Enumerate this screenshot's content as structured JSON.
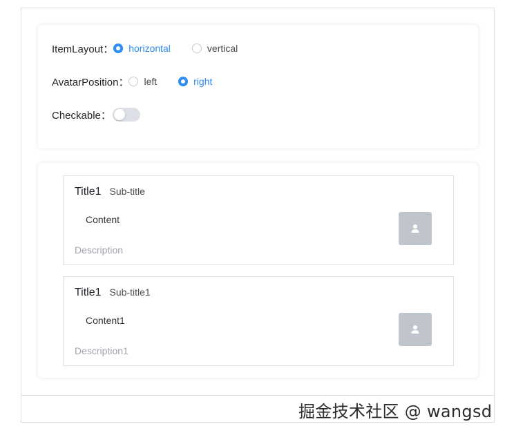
{
  "settings": {
    "item_layout": {
      "label": "ItemLayout：",
      "options": [
        {
          "label": "horizontal",
          "checked": true
        },
        {
          "label": "vertical",
          "checked": false
        }
      ]
    },
    "avatar_position": {
      "label": "AvatarPosition：",
      "options": [
        {
          "label": "left",
          "checked": false
        },
        {
          "label": "right",
          "checked": true
        }
      ]
    },
    "checkable": {
      "label": "Checkable：",
      "value": false
    }
  },
  "list": {
    "items": [
      {
        "title": "Title1",
        "subtitle": "Sub-title",
        "content": "Content",
        "description": "Description",
        "avatar_icon": "user-icon"
      },
      {
        "title": "Title1",
        "subtitle": "Sub-title1",
        "content": "Content1",
        "description": "Description1",
        "avatar_icon": "user-icon"
      }
    ]
  },
  "watermark": "掘金技术社区 @ wangsd",
  "colors": {
    "accent": "#2d8cf0",
    "border": "#dcdfe6",
    "avatar_bg": "#c0c4cc",
    "description": "#a0a4ab"
  }
}
